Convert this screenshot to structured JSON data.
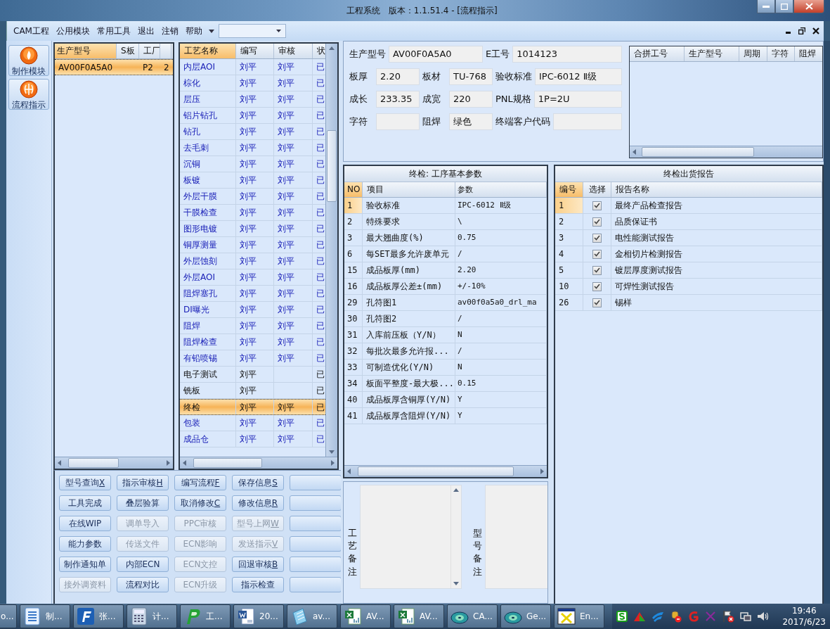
{
  "window": {
    "title": "工程系统   版本：1.1.51.4 - [流程指示]"
  },
  "menu": {
    "items": [
      "CAM工程",
      "公用模块",
      "常用工具",
      "退出",
      "注销",
      "帮助"
    ]
  },
  "sidebar": {
    "items": [
      {
        "label": "制作模块",
        "kind": "flame"
      },
      {
        "label": "流程指示",
        "kind": "globe"
      }
    ]
  },
  "model_table": {
    "columns": [
      "生产型号",
      "S板",
      "工厂"
    ],
    "rows": [
      {
        "model": "AV00F0A5A0",
        "factory": "P2",
        "column_4": "2",
        "selected": true
      }
    ]
  },
  "process_table": {
    "columns": [
      "工艺名称",
      "编写",
      "审核",
      "状"
    ],
    "rows": [
      {
        "name": "内层AOI",
        "author": "刘平",
        "reviewer": "刘平",
        "status": "已",
        "selected": false
      },
      {
        "name": "棕化",
        "author": "刘平",
        "reviewer": "刘平",
        "status": "已",
        "selected": false
      },
      {
        "name": "层压",
        "author": "刘平",
        "reviewer": "刘平",
        "status": "已",
        "selected": false
      },
      {
        "name": "铝片钻孔",
        "author": "刘平",
        "reviewer": "刘平",
        "status": "已",
        "selected": false
      },
      {
        "name": "钻孔",
        "author": "刘平",
        "reviewer": "刘平",
        "status": "已",
        "selected": false
      },
      {
        "name": "去毛刺",
        "author": "刘平",
        "reviewer": "刘平",
        "status": "已",
        "selected": false
      },
      {
        "name": "沉铜",
        "author": "刘平",
        "reviewer": "刘平",
        "status": "已",
        "selected": false
      },
      {
        "name": "板镀",
        "author": "刘平",
        "reviewer": "刘平",
        "status": "已",
        "selected": false
      },
      {
        "name": "外层干膜",
        "author": "刘平",
        "reviewer": "刘平",
        "status": "已",
        "selected": false
      },
      {
        "name": "干膜检查",
        "author": "刘平",
        "reviewer": "刘平",
        "status": "已",
        "selected": false
      },
      {
        "name": "图形电镀",
        "author": "刘平",
        "reviewer": "刘平",
        "status": "已",
        "selected": false
      },
      {
        "name": "铜厚测量",
        "author": "刘平",
        "reviewer": "刘平",
        "status": "已",
        "selected": false
      },
      {
        "name": "外层蚀刻",
        "author": "刘平",
        "reviewer": "刘平",
        "status": "已",
        "selected": false
      },
      {
        "name": "外层AOI",
        "author": "刘平",
        "reviewer": "刘平",
        "status": "已",
        "selected": false
      },
      {
        "name": "阻焊塞孔",
        "author": "刘平",
        "reviewer": "刘平",
        "status": "已",
        "selected": false
      },
      {
        "name": "DI曝光",
        "author": "刘平",
        "reviewer": "刘平",
        "status": "已",
        "selected": false
      },
      {
        "name": "阻焊",
        "author": "刘平",
        "reviewer": "刘平",
        "status": "已",
        "selected": false
      },
      {
        "name": "阻焊检查",
        "author": "刘平",
        "reviewer": "刘平",
        "status": "已",
        "selected": false
      },
      {
        "name": "有铅喷锡",
        "author": "刘平",
        "reviewer": "刘平",
        "status": "已",
        "selected": false
      },
      {
        "name": "电子测试",
        "author": "刘平",
        "status": "已",
        "selected": false
      },
      {
        "name": "铣板",
        "author": "刘平",
        "status": "已",
        "selected": false
      },
      {
        "name": "终检",
        "author": "刘平",
        "reviewer": "刘平",
        "status": "已",
        "selected": true
      },
      {
        "name": "包装",
        "author": "刘平",
        "reviewer": "刘平",
        "status": "已",
        "selected": false
      },
      {
        "name": "成品仓",
        "author": "刘平",
        "reviewer": "刘平",
        "status": "已",
        "selected": false
      }
    ]
  },
  "buttons": [
    [
      {
        "label": "型号查询",
        "hotkey": "X",
        "disabled": false
      },
      {
        "label": "指示审核",
        "hotkey": "H",
        "disabled": false
      },
      {
        "label": "编写流程",
        "hotkey": "F",
        "disabled": false
      },
      {
        "label": "保存信息",
        "hotkey": "S",
        "disabled": false
      },
      {
        "disabled": false
      }
    ],
    [
      {
        "label": "工具完成",
        "disabled": false
      },
      {
        "label": "叠层验算",
        "disabled": false
      },
      {
        "label": "取消修改",
        "hotkey": "C",
        "disabled": false
      },
      {
        "label": "修改信息",
        "hotkey": "R",
        "disabled": false
      },
      {
        "disabled": false
      }
    ],
    [
      {
        "label": "在线WIP",
        "disabled": false
      },
      {
        "label": "调单导入",
        "disabled": true
      },
      {
        "label": "PPC审核",
        "disabled": true
      },
      {
        "label": "型号上网",
        "hotkey": "W",
        "disabled": true
      },
      {
        "disabled": false
      }
    ],
    [
      {
        "label": "能力参数",
        "disabled": false
      },
      {
        "label": "传送文件",
        "disabled": true
      },
      {
        "label": "ECN影响",
        "disabled": true
      },
      {
        "label": "发送指示",
        "hotkey": "V",
        "disabled": true
      },
      {
        "disabled": false
      }
    ],
    [
      {
        "label": "制作通知单",
        "disabled": false
      },
      {
        "label": "内部ECN",
        "disabled": false
      },
      {
        "label": "ECN文控",
        "disabled": true
      },
      {
        "label": "回退审核",
        "hotkey": "B",
        "disabled": false
      },
      {
        "disabled": false
      }
    ],
    [
      {
        "label": "接外调资料",
        "disabled": true
      },
      {
        "label": "流程对比",
        "disabled": false
      },
      {
        "label": "ECN升级",
        "disabled": true
      },
      {
        "label": "指示检查",
        "disabled": false
      },
      {
        "disabled": false
      }
    ]
  ],
  "form": {
    "fields": [
      {
        "label": "生产型号",
        "value": "AV00F0A5A0"
      },
      {
        "label": "E工号",
        "value": "1014123"
      },
      {
        "label": "板厚",
        "value": "2.20"
      },
      {
        "label": "板材",
        "value": "TU-768"
      },
      {
        "label": "验收标准",
        "value": "IPC-6012 Ⅱ级"
      },
      {
        "label": "成长",
        "value": "233.35"
      },
      {
        "label": "成宽",
        "value": "220"
      },
      {
        "label": "PNL规格",
        "value": "1P=2U"
      },
      {
        "label": "字符"
      },
      {
        "label": "阻焊",
        "value": "绿色"
      },
      {
        "label": "终端客户代码"
      }
    ]
  },
  "merge_table": {
    "columns": [
      "合拼工号",
      "生产型号",
      "周期",
      "字符",
      "阻焊"
    ]
  },
  "params": {
    "title": "终检: 工序基本参数",
    "columns": [
      "NO",
      "项目",
      "参数"
    ],
    "rows": [
      {
        "no": "1",
        "item": "验收标准",
        "value": "IPC-6012 Ⅱ级",
        "selected": true
      },
      {
        "no": "2",
        "item": "特殊要求",
        "value": "\\",
        "selected": false
      },
      {
        "no": "3",
        "item": "最大翘曲度(%)",
        "value": "0.75",
        "selected": false
      },
      {
        "no": "6",
        "item": "每SET最多允许废单元",
        "value": "/",
        "selected": false
      },
      {
        "no": "15",
        "item": "成品板厚(mm)",
        "value": "2.20",
        "selected": false
      },
      {
        "no": "16",
        "item": "成品板厚公差±(mm)",
        "value": "+/-10%",
        "selected": false
      },
      {
        "no": "29",
        "item": "孔符图1",
        "value": "av00f0a5a0_drl_ma",
        "selected": false
      },
      {
        "no": "30",
        "item": "孔符图2",
        "value": "/",
        "selected": false
      },
      {
        "no": "31",
        "item": "入库前压板（Y/N）",
        "value": "N",
        "selected": false
      },
      {
        "no": "32",
        "item": "每批次最多允许报...",
        "value": "/",
        "selected": false
      },
      {
        "no": "33",
        "item": "可制造优化(Y/N)",
        "value": "N",
        "selected": false
      },
      {
        "no": "34",
        "item": "板面平整度-最大极...",
        "value": "0.15",
        "selected": false
      },
      {
        "no": "40",
        "item": "成品板厚含铜厚(Y/N)",
        "value": "Y",
        "selected": false
      },
      {
        "no": "41",
        "item": "成品板厚含阻焊(Y/N)",
        "value": "Y",
        "selected": false
      }
    ]
  },
  "notes": [
    {
      "label": "工艺备注"
    },
    {
      "label": "型号备注"
    }
  ],
  "report": {
    "title": "终检出货报告",
    "columns": [
      "编号",
      "选择",
      "报告名称"
    ],
    "rows": [
      {
        "no": "1",
        "checked": true,
        "name": "最终产品检查报告",
        "selected": true
      },
      {
        "no": "2",
        "checked": true,
        "name": "品质保证书",
        "selected": false
      },
      {
        "no": "3",
        "checked": true,
        "name": "电性能测试报告",
        "selected": false
      },
      {
        "no": "4",
        "checked": true,
        "name": "金相切片检测报告",
        "selected": false
      },
      {
        "no": "5",
        "checked": true,
        "name": "镀层厚度测试报告",
        "selected": false
      },
      {
        "no": "10",
        "checked": true,
        "name": "可焊性测试报告",
        "selected": false
      },
      {
        "no": "26",
        "checked": true,
        "name": "锡样",
        "selected": false
      }
    ]
  },
  "taskbar": {
    "items": [
      {
        "label": "o...",
        "kind": "partial"
      },
      {
        "label": "制...",
        "kind": "doc"
      },
      {
        "label": "张...",
        "kind": "fapp"
      },
      {
        "label": "计...",
        "kind": "calc"
      },
      {
        "label": "工...",
        "kind": "papp"
      },
      {
        "label": "20...",
        "kind": "word"
      },
      {
        "label": "av...",
        "kind": "notepad"
      },
      {
        "label": "AV...",
        "kind": "excel"
      },
      {
        "label": "AV...",
        "kind": "excel"
      },
      {
        "label": "CA...",
        "kind": "disc"
      },
      {
        "label": "Ge...",
        "kind": "disc"
      },
      {
        "label": "En...",
        "kind": "xwin"
      }
    ],
    "time": "19:46",
    "date": "2017/6/23"
  }
}
